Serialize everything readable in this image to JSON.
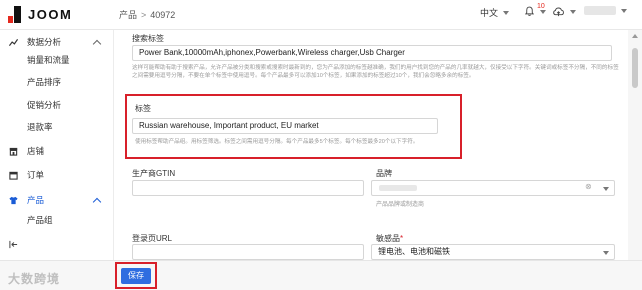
{
  "app": {
    "logo_text": "JOOM"
  },
  "breadcrumb": {
    "section": "产品",
    "separator": ">",
    "item_id": "40972"
  },
  "topbar": {
    "language": "中文",
    "notification_count": "10"
  },
  "sidebar": {
    "items": [
      {
        "label": "数据分析",
        "icon": "chart-icon",
        "expandable": true,
        "expanded": true
      },
      {
        "label": "销量和流量"
      },
      {
        "label": "产品排序"
      },
      {
        "label": "促销分析"
      },
      {
        "label": "退款率"
      },
      {
        "label": "店铺",
        "icon": "store-icon"
      },
      {
        "label": "订单",
        "icon": "order-icon"
      },
      {
        "label": "产品",
        "icon": "product-icon",
        "expandable": true,
        "expanded": true,
        "active": true
      },
      {
        "label": "产品组"
      }
    ],
    "collapse_icon": "collapse-icon"
  },
  "form": {
    "search_tags": {
      "label": "搜索标签",
      "value": "Power Bank,10000mAh,iphonex,Powerbank,Wireless charger,Usb Charger",
      "help": "这样可能帮助有助于搜索产品，允许产品被分类和搜索或搜索时最新到的，您为产品添加的标签越准确，我们的用户找到您的产品的几率就越大，仅接受以下字符。关键词或标签不分隔，不同的标签之间需要用逗号分隔，不要在单个标签中使用逗号。每个产品最多可以添加10个标签，如果添加的标签超过10个，我们会忽略多余的标签。"
    },
    "tags": {
      "label": "标签",
      "value": "Russian warehouse, Important product, EU market",
      "help": "使用标签帮助产品组。用标签筛选。标签之间需用逗号分隔。每个产品最多5个标签。每个标签最多20个以下字符。"
    },
    "gtin": {
      "label": "生产商GTIN",
      "value": ""
    },
    "brand": {
      "label": "品牌",
      "help": "产品品牌或制造商"
    },
    "landing_url": {
      "label": "登录页URL",
      "value": ""
    },
    "sensitive": {
      "label": "敏感品",
      "required_mark": "*",
      "value": "锂电池、电池和磁铁"
    }
  },
  "footer": {
    "save_label": "保存",
    "watermark": "大数跨境"
  },
  "colors": {
    "accent": "#2f6de0",
    "highlight": "#d8202a",
    "active_nav": "#1a5cd6"
  }
}
